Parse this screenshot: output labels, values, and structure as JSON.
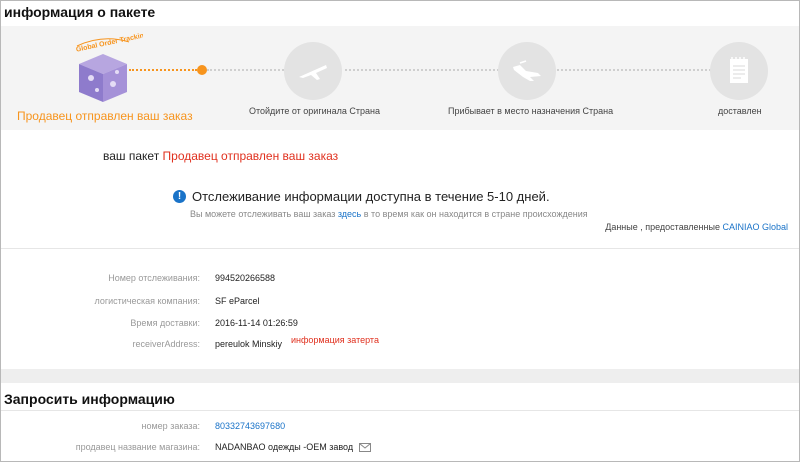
{
  "package_section": {
    "title": "информация о пакете"
  },
  "progress": {
    "hero_badge_text": "Global Order Tracking",
    "steps": [
      {
        "label": "Продавец отправлен ваш заказ",
        "active": true
      },
      {
        "label": "Отойдите от оригинала Страна",
        "active": false
      },
      {
        "label": "Прибывает в место назначения Страна",
        "active": false
      },
      {
        "label": "доставлен",
        "active": false
      }
    ],
    "accent_color": "#f7941d"
  },
  "status": {
    "prefix": "ваш пакет",
    "value": "Продавец отправлен ваш заказ"
  },
  "notice": {
    "title": "Отслеживание информации доступна в течение 5-10 дней.",
    "sub_prefix": "Вы можете отслеживать ваш заказ",
    "sub_link": "здесь",
    "sub_suffix": "в то время как он находится в стране происхождения"
  },
  "provider": {
    "prefix": "Данные , предоставленные",
    "name": "CAINIAO Global"
  },
  "details": [
    {
      "label": "Номер отслеживания:",
      "value": "994520266588"
    },
    {
      "label": "логистическая компания:",
      "value": "SF eParcel"
    },
    {
      "label": "Время доставки:",
      "value": "2016-11-14 01:26:59"
    },
    {
      "label": "receiverAddress:",
      "value": "pereulok Minskiy",
      "masked_note": "информация затерта"
    }
  ],
  "request_section": {
    "title": "Запросить информацию",
    "rows": [
      {
        "label": "номер заказа:",
        "value": "80332743697680"
      },
      {
        "label": "продавец название магазина:",
        "value": "NADANBAO одежды -OEM завод"
      }
    ]
  },
  "colors": {
    "link": "#1a73c8",
    "highlight": "#e0301e",
    "info_icon": "#1a73c8"
  },
  "icons": {
    "step2": "airplane-takeoff-icon",
    "step3": "airplane-landing-icon",
    "step4": "receipt-icon",
    "notice": "info-icon",
    "contact": "mail-icon"
  }
}
